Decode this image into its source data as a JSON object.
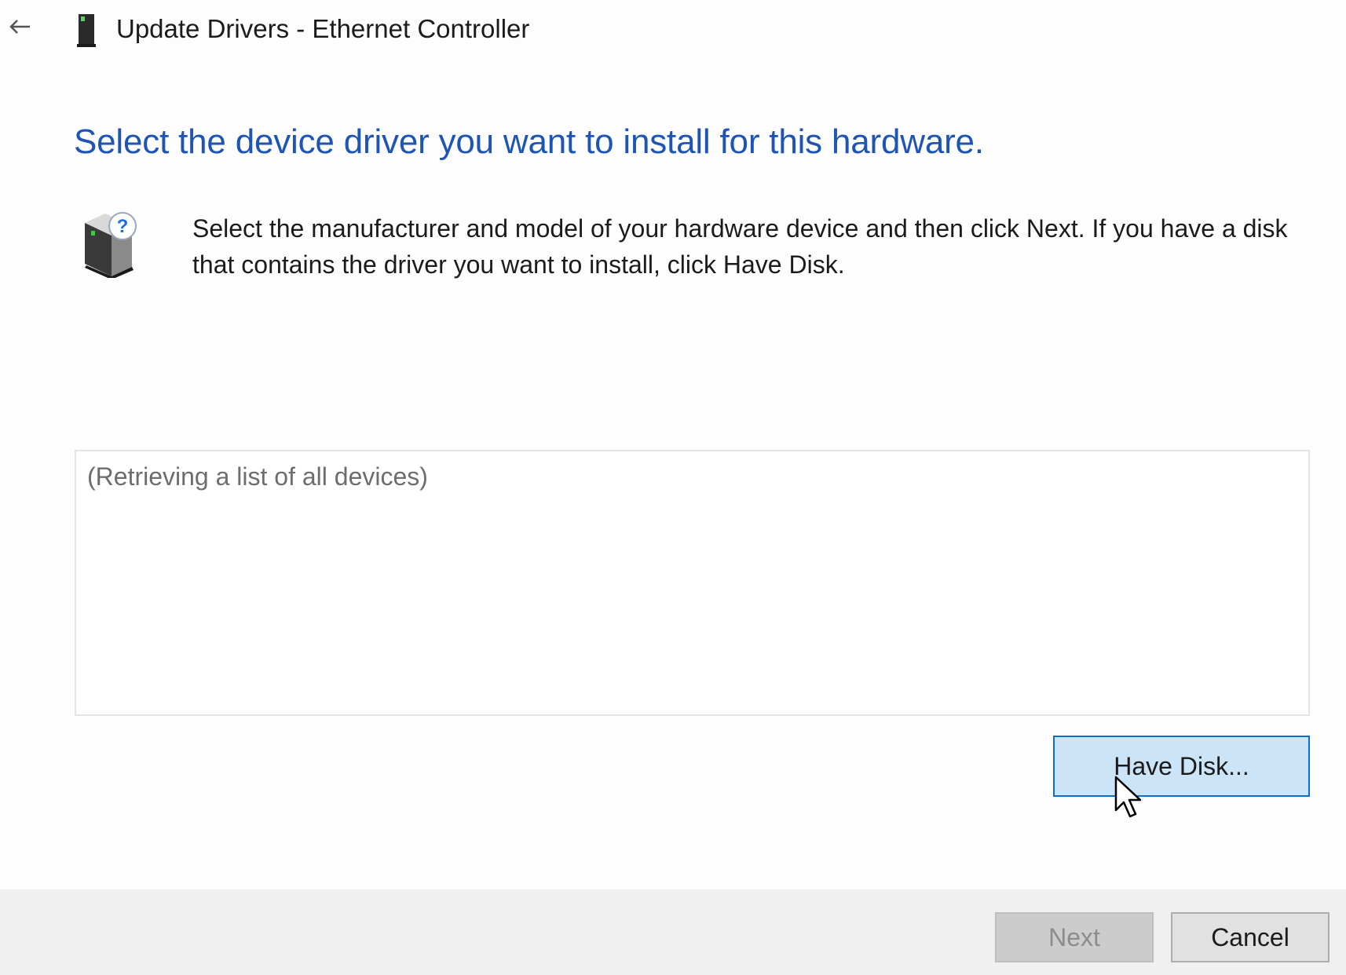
{
  "window": {
    "title": "Update Drivers - Ethernet Controller",
    "title_icon": "network-adapter-icon",
    "back_icon": "back-arrow-icon"
  },
  "main": {
    "heading": "Select the device driver you want to install for this hardware.",
    "instruction_icon": "hardware-question-icon",
    "instruction": "Select the manufacturer and model of your hardware device and then click Next. If you have a disk that contains the driver you want to install, click Have Disk.",
    "device_list": {
      "status_text": "(Retrieving a list of all devices)"
    },
    "have_disk_label": "Have Disk..."
  },
  "footer": {
    "next_label": "Next",
    "next_enabled": false,
    "cancel_label": "Cancel"
  },
  "colors": {
    "heading": "#1e55b3",
    "button_hover_bg": "#cce4f7",
    "button_hover_border": "#0a6fcc",
    "footer_bg": "#f0f0f0"
  }
}
